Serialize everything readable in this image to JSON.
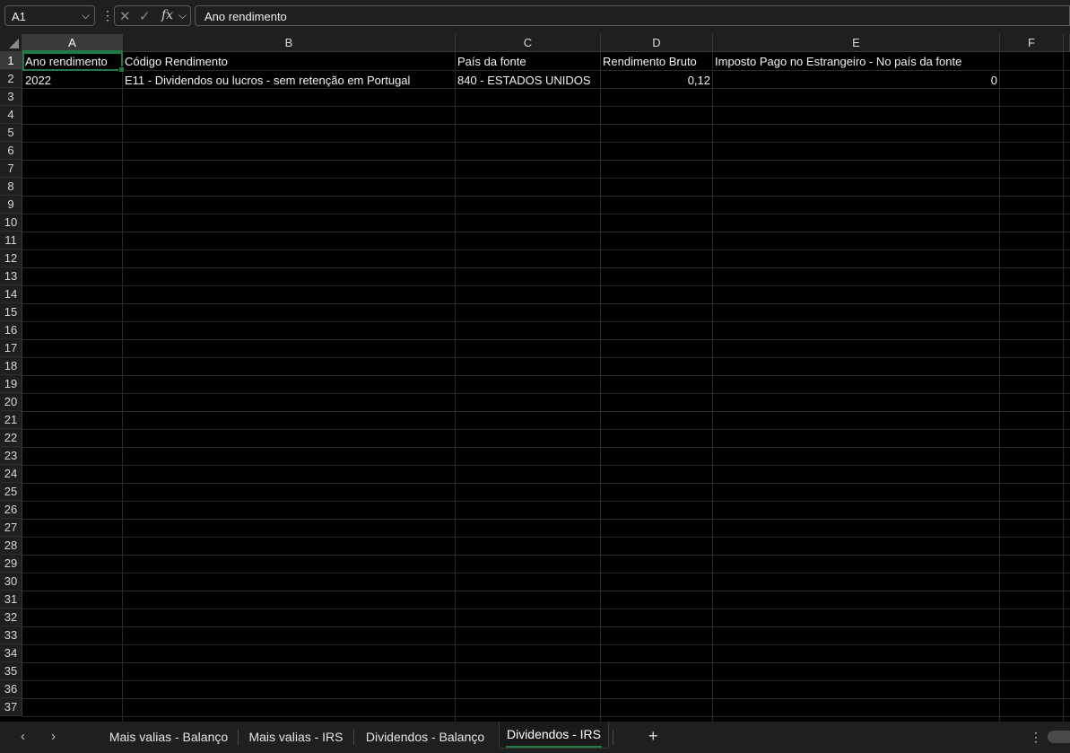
{
  "formula_bar": {
    "name_box": "A1",
    "cancel_icon": "✕",
    "enter_icon": "✓",
    "fx_label": "fx",
    "formula": "Ano rendimento"
  },
  "columns": [
    "A",
    "B",
    "C",
    "D",
    "E",
    "F"
  ],
  "rows": [
    "1",
    "2",
    "3",
    "4",
    "5",
    "6",
    "7",
    "8",
    "9",
    "10",
    "11",
    "12",
    "13",
    "14",
    "15",
    "16",
    "17",
    "18",
    "19",
    "20",
    "21",
    "22",
    "23",
    "24",
    "25",
    "26",
    "27",
    "28",
    "29",
    "30",
    "31",
    "32",
    "33",
    "34",
    "35",
    "36",
    "37"
  ],
  "cells": {
    "r1": [
      "Ano rendimento",
      "Código Rendimento",
      "País da fonte",
      "Rendimento Bruto",
      "Imposto Pago no Estrangeiro - No país da fonte"
    ],
    "r2": [
      "2022",
      "E11 - Dividendos ou lucros - sem retenção em Portugal",
      "840 - ESTADOS UNIDOS",
      "0,12",
      "0"
    ]
  },
  "sheet_tabs": [
    "Mais valias - Balanço",
    "Mais valias - IRS",
    "Dividendos - Balanço",
    "Dividendos - IRS"
  ],
  "active_tab": "Dividendos - IRS",
  "add_tab_label": "+",
  "theme": {
    "accent": "#1f7a46",
    "background": "#000000",
    "chrome": "#1f1f1f"
  }
}
